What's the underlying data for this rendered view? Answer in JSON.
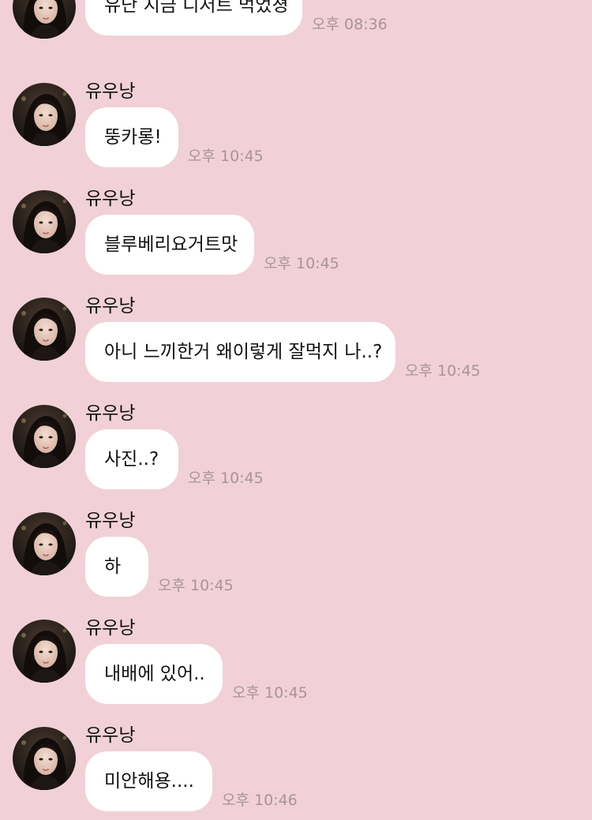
{
  "sender_name": "유우낭",
  "messages": [
    {
      "text": "유난 지금 디저트 먹었졍",
      "time": "오후 08:36",
      "show_sender": false
    },
    {
      "text": "뚱카롱!",
      "time": "오후 10:45",
      "show_sender": true
    },
    {
      "text": "블루베리요거트맛",
      "time": "오후 10:45",
      "show_sender": true
    },
    {
      "text": "아니 느끼한거 왜이렇게 잘먹지 나..?",
      "time": "오후 10:45",
      "show_sender": true
    },
    {
      "text": "사진..?",
      "time": "오후 10:45",
      "show_sender": true
    },
    {
      "text": "하",
      "time": "오후 10:45",
      "show_sender": true
    },
    {
      "text": "내배에 있어..",
      "time": "오후 10:45",
      "show_sender": true
    },
    {
      "text": "미안해용....",
      "time": "오후 10:46",
      "show_sender": true
    }
  ],
  "colors": {
    "background": "#f1d1d7",
    "bubble": "#ffffff",
    "timestamp": "#a79498",
    "text": "#111111"
  },
  "icons": {
    "avatar": "profile-photo-avatar"
  }
}
